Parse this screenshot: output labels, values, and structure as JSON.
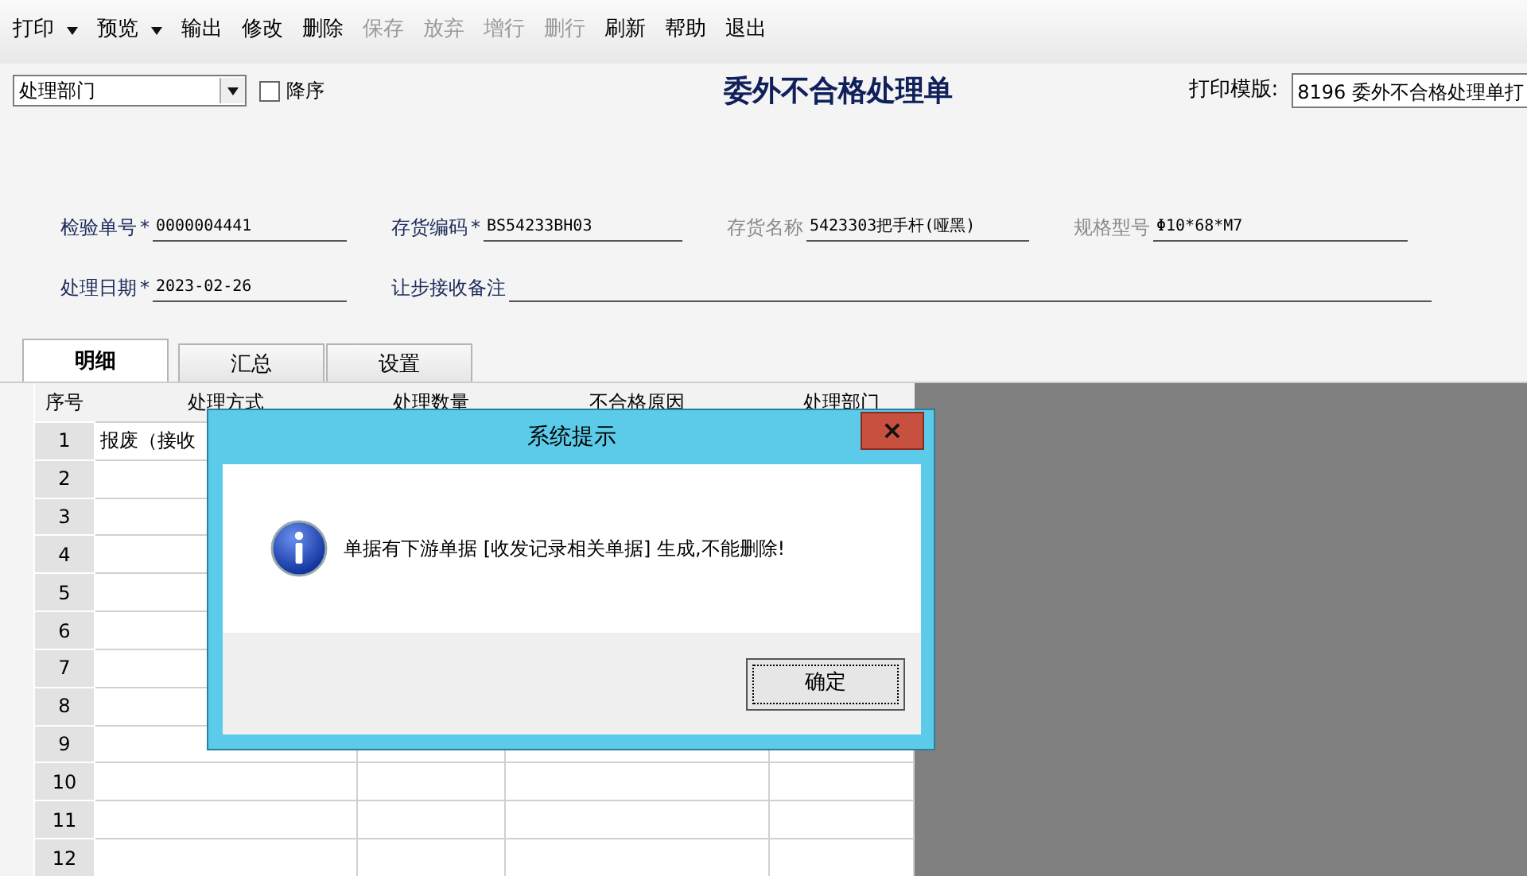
{
  "toolbar": [
    {
      "label": "打印",
      "dropdown": true,
      "disabled": false
    },
    {
      "label": "预览",
      "dropdown": true,
      "disabled": false
    },
    {
      "label": "输出",
      "dropdown": false,
      "disabled": false
    },
    {
      "label": "修改",
      "dropdown": false,
      "disabled": false
    },
    {
      "label": "删除",
      "dropdown": false,
      "disabled": false
    },
    {
      "label": "保存",
      "dropdown": false,
      "disabled": true
    },
    {
      "label": "放弃",
      "dropdown": false,
      "disabled": true
    },
    {
      "label": "增行",
      "dropdown": false,
      "disabled": true
    },
    {
      "label": "删行",
      "dropdown": false,
      "disabled": true
    },
    {
      "label": "刷新",
      "dropdown": false,
      "disabled": false
    },
    {
      "label": "帮助",
      "dropdown": false,
      "disabled": false
    },
    {
      "label": "退出",
      "dropdown": false,
      "disabled": false
    }
  ],
  "sort_select": {
    "value": "处理部门"
  },
  "descending": {
    "label": "降序",
    "checked": false
  },
  "title": "委外不合格处理单",
  "print_template": {
    "label": "打印模版:",
    "value": "8196 委外不合格处理单打"
  },
  "fields": [
    [
      {
        "label": "检验单号",
        "required_mark": "*",
        "disabled": false,
        "value": "0000004441"
      },
      {
        "label": "存货编码",
        "required_mark": "*",
        "disabled": false,
        "value": "BS54233BH03"
      },
      {
        "label": "存货名称",
        "disabled": true,
        "value": "5423303把手杆(哑黑)"
      },
      {
        "label": "规格型号",
        "disabled": true,
        "value": "Φ10*68*M7"
      }
    ],
    [
      {
        "label": "处理日期",
        "required_mark": "*",
        "disabled": false,
        "value": "2023-02-26"
      },
      {
        "label": "让步接收备注",
        "disabled": false
      }
    ]
  ],
  "tabs": [
    {
      "label": "明细",
      "selected": true
    },
    {
      "label": "汇总",
      "selected": false
    },
    {
      "label": "设置",
      "selected": false
    }
  ],
  "table": {
    "columns": [
      "序号",
      "处理方式",
      "处理数量",
      "不合格原因",
      "处理部门"
    ],
    "rows": [
      [
        "1",
        "报废（接收"
      ],
      [
        "2"
      ],
      [
        "3"
      ],
      [
        "4"
      ],
      [
        "5"
      ],
      [
        "6"
      ],
      [
        "7"
      ],
      [
        "8"
      ],
      [
        "9"
      ],
      [
        "10"
      ],
      [
        "11"
      ],
      [
        "12"
      ]
    ]
  },
  "dialog": {
    "title": "系统提示",
    "close": "×",
    "message": "单据有下游单据 [收发记录相关单据] 生成,不能删除!",
    "button": "确定"
  }
}
